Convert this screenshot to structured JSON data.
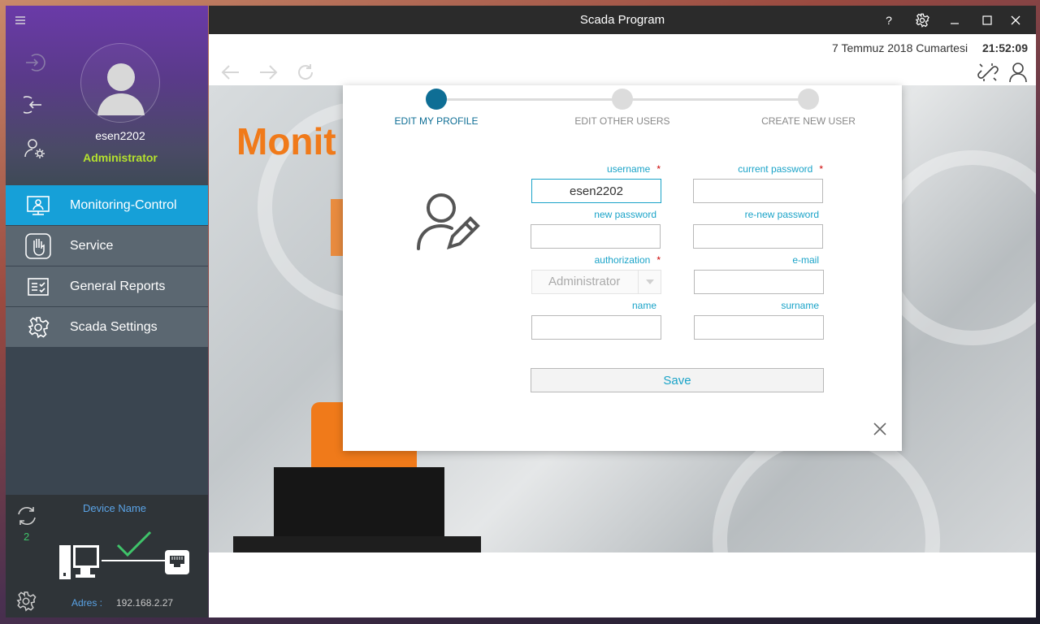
{
  "window": {
    "title": "Scada Program",
    "help_label": "?",
    "date": "7 Temmuz 2018 Cumartesi",
    "time": "21:52:09"
  },
  "user": {
    "name": "esen2202",
    "role": "Administrator"
  },
  "nav": {
    "items": [
      {
        "label": "Monitoring-Control",
        "active": true
      },
      {
        "label": "Service",
        "active": false
      },
      {
        "label": "General Reports",
        "active": false
      },
      {
        "label": "Scada Settings",
        "active": false
      }
    ]
  },
  "device": {
    "name_label": "Device Name",
    "sync_count": "2",
    "address_label": "Adres :",
    "address": "192.168.2.27"
  },
  "background": {
    "title_fragment": "Monit"
  },
  "dialog": {
    "steps": [
      {
        "label": "EDIT MY PROFILE",
        "active": true
      },
      {
        "label": "EDIT OTHER USERS",
        "active": false
      },
      {
        "label": "CREATE NEW USER",
        "active": false
      }
    ],
    "fields": {
      "username": {
        "label": "username",
        "value": "esen2202",
        "required": "*"
      },
      "current_password": {
        "label": "current password",
        "value": "",
        "required": "*"
      },
      "new_password": {
        "label": "new password",
        "value": ""
      },
      "renew_password": {
        "label": "re-new password",
        "value": ""
      },
      "authorization": {
        "label": "authorization",
        "value": "Administrator",
        "required": "*"
      },
      "email": {
        "label": "e-mail",
        "value": ""
      },
      "name": {
        "label": "name",
        "value": ""
      },
      "surname": {
        "label": "surname",
        "value": ""
      }
    },
    "save_label": "Save"
  },
  "colors": {
    "accent": "#16a0d8",
    "step_active": "#0e6e95",
    "role_green": "#b5e22e",
    "brand_orange": "#f07a1a"
  }
}
